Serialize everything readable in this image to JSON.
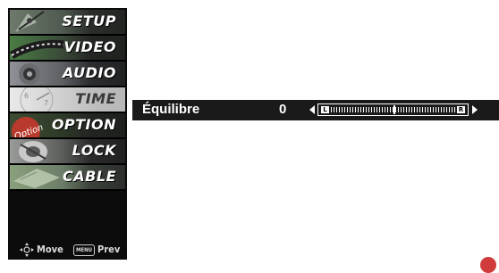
{
  "menu": {
    "items": [
      {
        "label": "SETUP"
      },
      {
        "label": "VIDEO"
      },
      {
        "label": "AUDIO"
      },
      {
        "label": "TIME"
      },
      {
        "label": "OPTION"
      },
      {
        "label": "LOCK"
      },
      {
        "label": "CABLE"
      }
    ],
    "selected_index": 3,
    "footer": {
      "move_label": "Move",
      "menu_key_label": "MENU",
      "prev_label": "Prev"
    }
  },
  "balance": {
    "label": "Équilibre",
    "value": "0",
    "left_tag": "L",
    "right_tag": "R"
  },
  "colors": {
    "menu_bg": "#0c0c0c",
    "bar_bg": "#1a1a1a",
    "selected_bg": "#d6d6d6",
    "accent": "#d23b3b"
  }
}
